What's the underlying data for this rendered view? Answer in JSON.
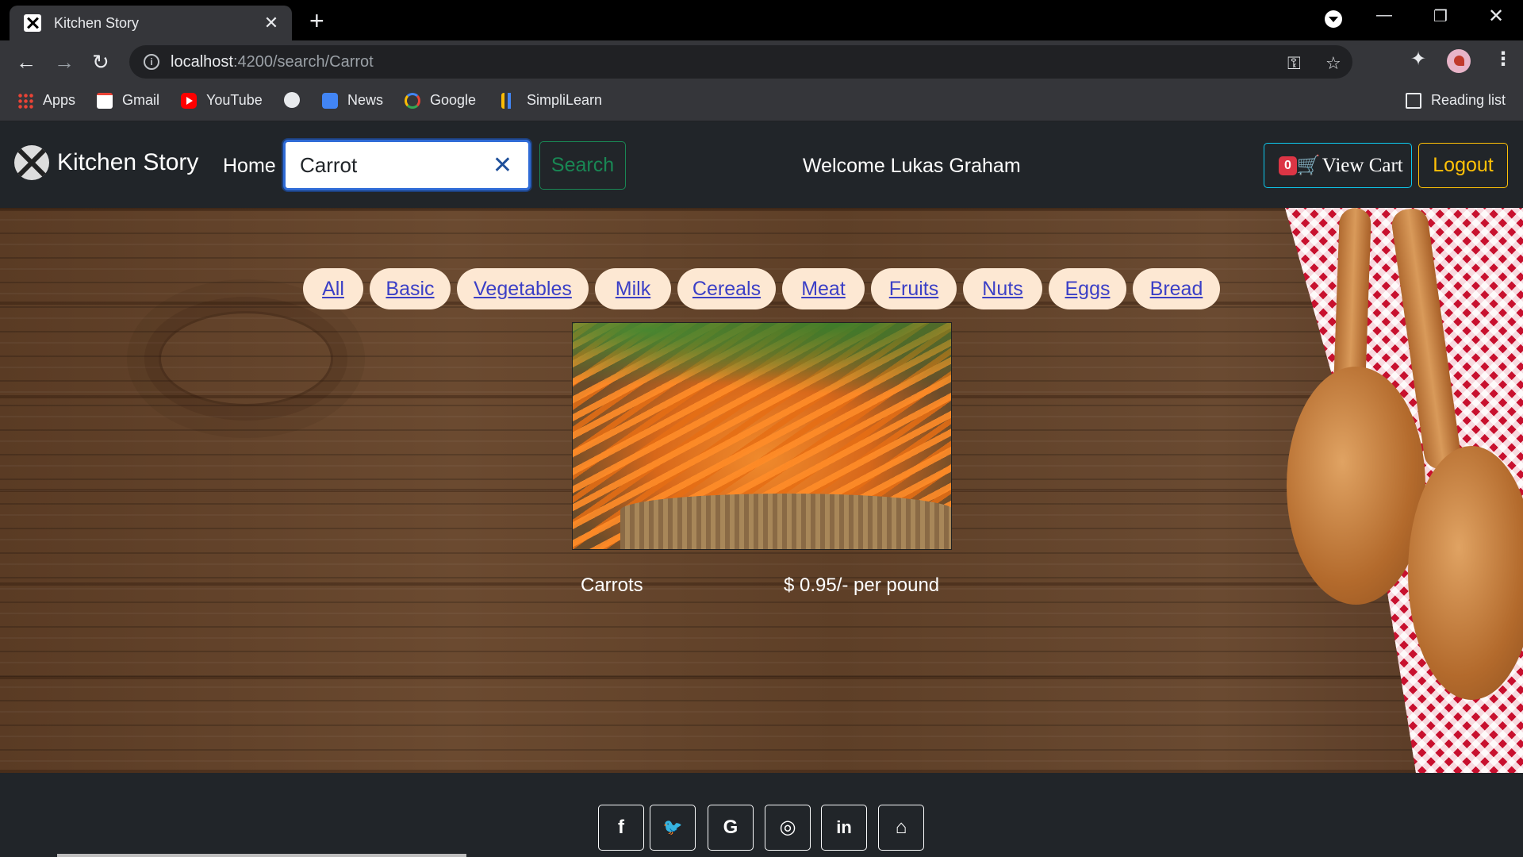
{
  "browser": {
    "tab_title": "Kitchen Story",
    "tab_close": "✕",
    "new_tab": "+",
    "url_host": "localhost",
    "url_path": ":4200/search/Carrot",
    "bookmarks": [
      "Apps",
      "Gmail",
      "YouTube",
      "",
      "News",
      "Google",
      "SimpliLearn"
    ],
    "reading_list": "Reading list"
  },
  "navbar": {
    "brand": "Kitchen Story",
    "home": "Home",
    "search_value": "Carrot",
    "clear_icon": "✕",
    "search_button": "Search",
    "welcome": "Welcome Lukas Graham",
    "cart_count": "0",
    "cart_label": "View Cart",
    "logout": "Logout"
  },
  "categories": [
    "All",
    "Basic",
    "Vegetables",
    "Milk",
    "Cereals",
    "Meat",
    "Fruits",
    "Nuts",
    "Eggs",
    "Bread"
  ],
  "product": {
    "name": "Carrots",
    "price": "$ 0.95/- per pound"
  },
  "footer": {
    "social_icons": [
      "facebook-icon",
      "twitter-icon",
      "google-icon",
      "instagram-icon",
      "linkedin-icon",
      "github-icon"
    ],
    "social_glyphs": [
      "f",
      "🐦",
      "G",
      "◎",
      "in",
      "⌂"
    ]
  },
  "colors": {
    "search_btn": "#198754",
    "cart_border": "#0dcaf0",
    "logout": "#ffc107",
    "badge": "#dc3545",
    "category_pill": "#fde8d3",
    "category_link": "#3b3fc6"
  }
}
